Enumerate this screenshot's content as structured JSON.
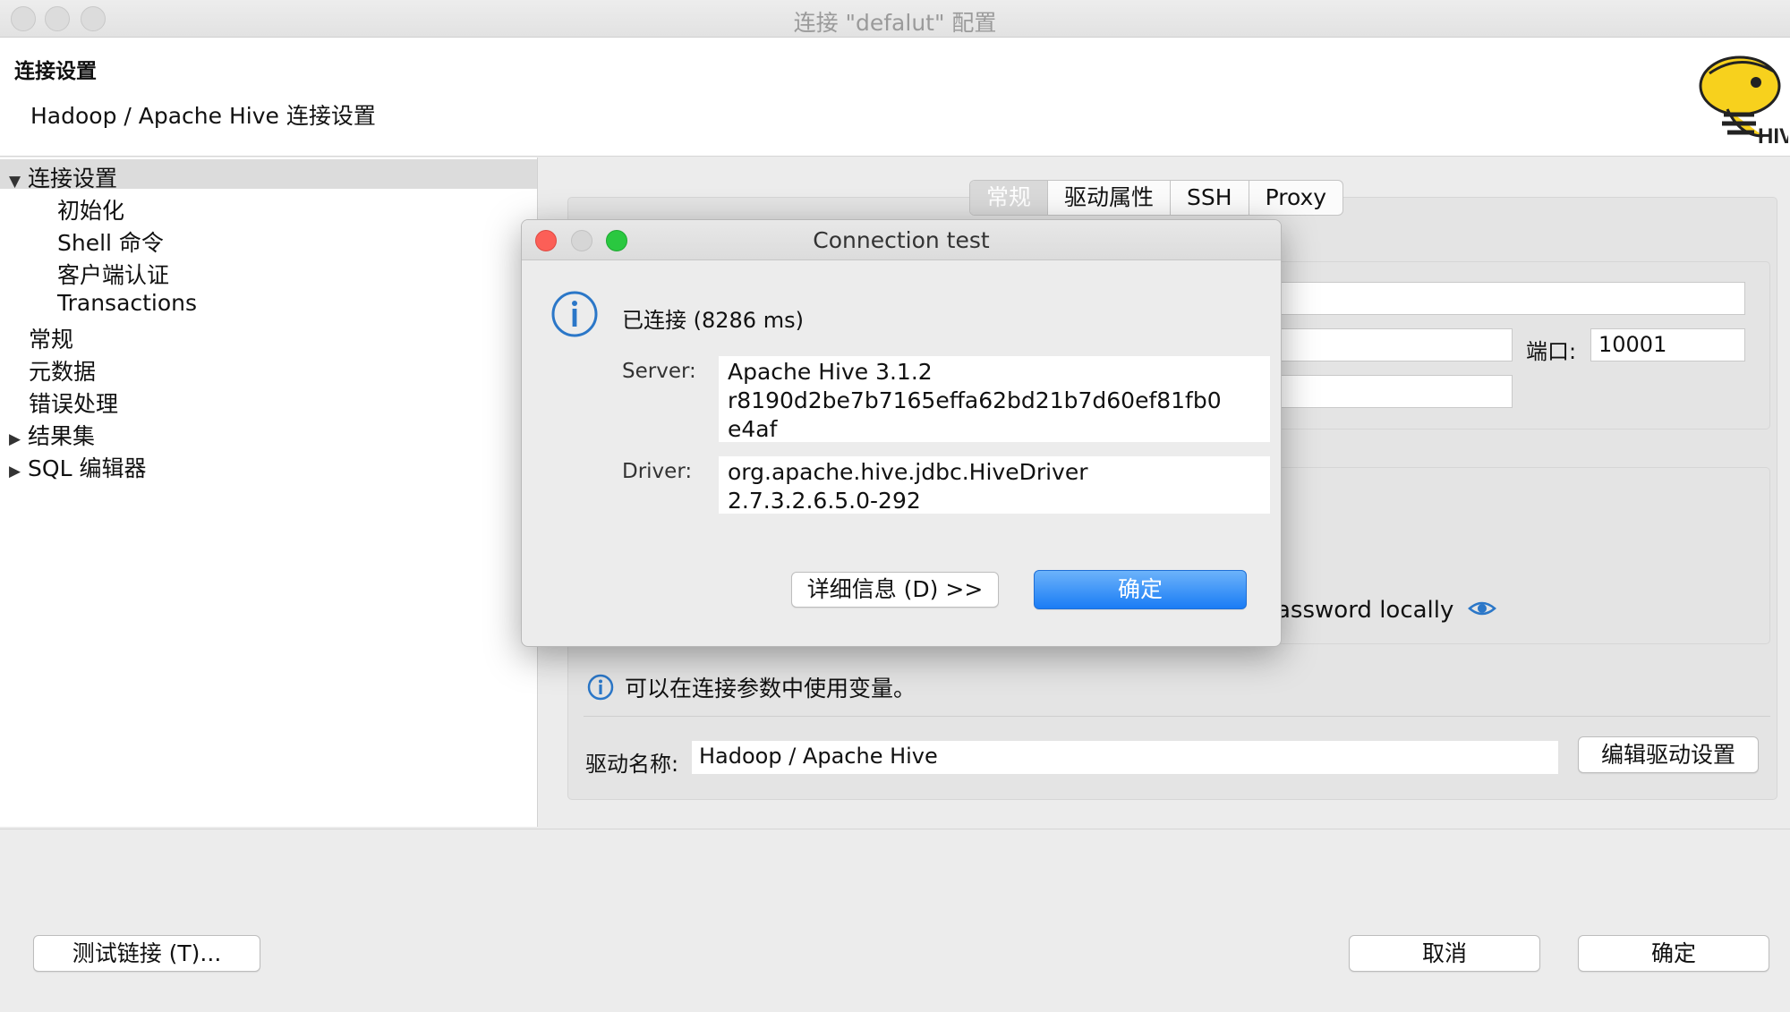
{
  "window": {
    "title": "连接 \"defalut\" 配置"
  },
  "header": {
    "title": "连接设置",
    "subtitle": "Hadoop / Apache Hive 连接设置",
    "logo_icon": "hive-bee-logo"
  },
  "sidebar": {
    "items": [
      {
        "label": "连接设置",
        "expander": "▼",
        "selected": true
      },
      {
        "label": "初始化"
      },
      {
        "label": "Shell 命令"
      },
      {
        "label": "客户端认证"
      },
      {
        "label": "Transactions"
      },
      {
        "label": "常规"
      },
      {
        "label": "元数据"
      },
      {
        "label": "错误处理"
      },
      {
        "label": "结果集",
        "expander": "▶"
      },
      {
        "label": "SQL 编辑器",
        "expander": "▶"
      }
    ]
  },
  "tabs": [
    "常规",
    "驱动属性",
    "SSH",
    "Proxy"
  ],
  "form": {
    "port_label": "端口:",
    "port_value": "10001",
    "password_text": "assword locally",
    "info_text": "可以在连接参数中使用变量。",
    "driver_label": "驱动名称:",
    "driver_value": "Hadoop / Apache Hive",
    "edit_driver_button": "编辑驱动设置"
  },
  "footer": {
    "test_button": "测试链接 (T)...",
    "cancel_button": "取消",
    "ok_button": "确定"
  },
  "dialog": {
    "title": "Connection test",
    "message": "已连接 (8286 ms)",
    "server_label": "Server:",
    "server_lines": [
      "Apache Hive 3.1.2",
      "r8190d2be7b7165effa62bd21b7d60ef81fb0",
      "e4af"
    ],
    "driver_label": "Driver:",
    "driver_lines": [
      "org.apache.hive.jdbc.HiveDriver",
      "2.7.3.2.6.5.0-292"
    ],
    "details_button": "详细信息 (D) >>",
    "ok_button": "确定"
  },
  "colors": {
    "accent": "#1a7cf5",
    "close": "#fc5f57",
    "zoom": "#2ac840",
    "info": "#2b77c8",
    "logo_yellow": "#f7d11d"
  }
}
